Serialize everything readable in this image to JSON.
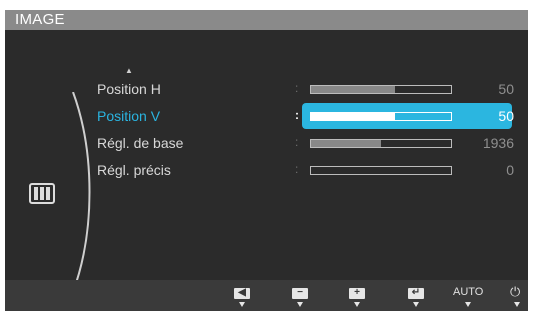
{
  "window": {
    "title": "IMAGE"
  },
  "menu": {
    "items": [
      {
        "label": "Position H",
        "value": "50",
        "level": 0.6,
        "selected": false
      },
      {
        "label": "Position V",
        "value": "50",
        "level": 0.6,
        "selected": true
      },
      {
        "label": "Régl. de base",
        "value": "1936",
        "level": 0.5,
        "selected": false
      },
      {
        "label": "Régl. précis",
        "value": "0",
        "level": 0.0,
        "selected": false
      }
    ]
  },
  "buttons": {
    "left": "◀",
    "minus": "−",
    "plus": "+",
    "enter": "↵",
    "auto": "AUTO",
    "power": "⏻"
  },
  "colors": {
    "accent": "#2bb6e0",
    "panel": "#2b2b2b",
    "title_bar": "#8a8a8a"
  }
}
